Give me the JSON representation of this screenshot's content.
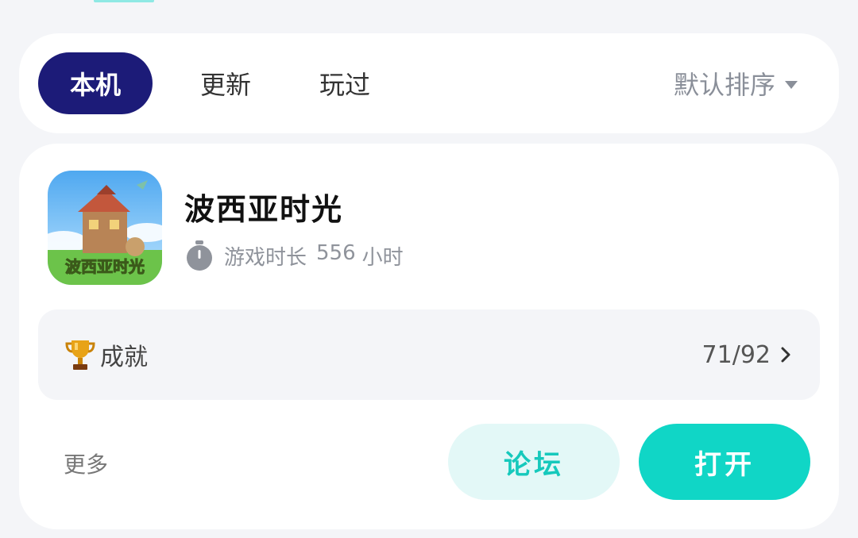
{
  "tabs": {
    "items": [
      {
        "label": "本机",
        "active": true
      },
      {
        "label": "更新",
        "active": false
      },
      {
        "label": "玩过",
        "active": false
      }
    ],
    "sort_label": "默认排序"
  },
  "game": {
    "title": "波西亚时光",
    "icon_text": "波西亚时光",
    "playtime_label": "游戏时长",
    "playtime_value": "556",
    "playtime_unit": "小时"
  },
  "achievements": {
    "label": "成就",
    "progress": "71/92"
  },
  "actions": {
    "more_label": "更多",
    "forum_label": "论坛",
    "open_label": "打开"
  },
  "colors": {
    "active_tab_bg": "#1c1b78",
    "accent_teal": "#10d6c6",
    "forum_bg": "#e3f8f7",
    "page_bg": "#f4f5f8"
  }
}
